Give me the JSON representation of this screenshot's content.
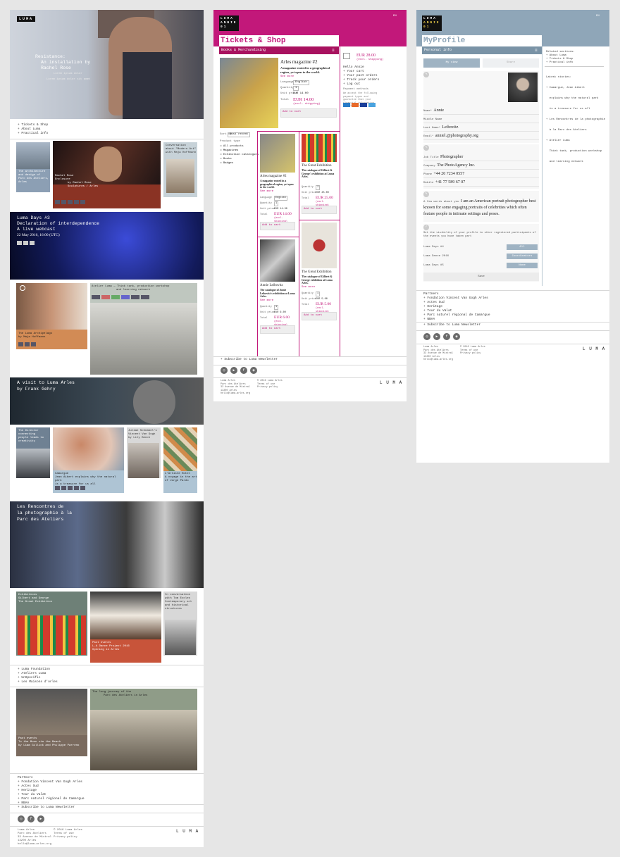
{
  "home": {
    "logo": "LUMA",
    "hero": {
      "title": "Resistance:",
      "subtitle": "An installation by",
      "artist": "Rachel Rose",
      "caption_line1": "Lorem ipsum dolor",
      "caption_line2": "Lorem ipsum dolor sit amet"
    },
    "top_links": [
      "+ Tickets & Shop",
      "+ About Luma",
      "+ Practical info"
    ],
    "tile_architecture": {
      "line1": "The architecture",
      "line2": "and design of",
      "line3": "Parc des Ateliers,",
      "line4": "Arles"
    },
    "tile_rachel": {
      "line1": "Rachel Rose",
      "line2": "Enclosure",
      "line3": "by Rachel Rose",
      "line4": "Sculptures / Arles"
    },
    "tile_hoffmann": {
      "line1": "Conversation",
      "line2": "about \"Modern Art\"",
      "line3": "with Maja Hoffmann"
    },
    "luma_days": {
      "line1": "Luma Days #3",
      "line2": "Declaration of interdependence",
      "line3": "A live webcast",
      "date": "22 May 2016, 16:00 (UTC)"
    },
    "tile_archipelago": {
      "line1": "The Luma Archipelago",
      "line2": "by Maja Hoffmann"
    },
    "tile_atelier": {
      "line1": "Atelier Luma",
      "line2": "— Think tank, production workshop",
      "line3": "and learning network"
    },
    "gehry": {
      "line1": "A visit to Luma Arles",
      "line2": "by Frank Gehry"
    },
    "tile_director": {
      "line1": "The Director",
      "line2": "connecting",
      "line3": "people leads to",
      "line4": "creativity"
    },
    "tile_camargue": {
      "line1": "Camargue",
      "line2": "Jean Aibert explains why the natural park",
      "line3": "is a treasure for us all"
    },
    "tile_vangogh": {
      "line1": "Julian Schnabel's",
      "line2": "Vincent Van Gogh",
      "line3": "by Lily Bench"
    },
    "tile_artiste": {
      "line1": "L'Artiste Hotel",
      "line2": "A voyage in the art",
      "line3": "of Jorge Pardo"
    },
    "rencontres": {
      "line1": "Les Rencontres de",
      "line2": "la photographie à la",
      "line3": "Parc des Ateliers"
    },
    "tile_gilbert": {
      "line1": "Exhibitions",
      "line2": "Gilbert and George",
      "line3": "The Great Exhibition"
    },
    "tile_santa": {
      "line1": "Past events",
      "line2": "L.A Dance Project 2016",
      "line3": "Opening in Arles"
    },
    "tile_ecoles": {
      "line1": "In conversation",
      "line2": "with Tom Eccles",
      "line3": "Contemporary art",
      "line4": "and historical",
      "line5": "structures"
    },
    "mid_links": [
      "+ Luma Foundation",
      "+ Ateliers Luma",
      "+ UnSpecific",
      "+ Les Maisons d'Arles"
    ],
    "tile_moon": {
      "line1": "Past events",
      "line2": "To the Moon via the Beach",
      "line3": "by Liam Gillick and Philippe Parreno"
    },
    "tile_journey": {
      "line1": "The long journey of the",
      "line2": "Parc des Ateliers in Arles"
    },
    "partners_title": "Partners",
    "partners": [
      "+ Fondation Vincent Van Gogh Arles",
      "+ Actes Sud",
      "+ Heritage",
      "+ Tour du Valat",
      "+ Parc naturel régional de Camargue",
      "+ NBAA"
    ],
    "newsletter": "+ Subscribe to Luma Newsletter",
    "footer_addr": [
      "Luma Arles",
      "Parc des Ateliers",
      "33 Avenue de Mistral",
      "13200 Arles",
      "hello@luma-arles.org"
    ],
    "footer_legal": [
      "© 2016 Luma Arles",
      "Terms of use",
      "Privacy policy"
    ],
    "wordmark": "L U M A"
  },
  "shop": {
    "logo_line1": "LUMA",
    "logo_line2": "ANNIE",
    "logo_line3": "01",
    "lang": "EN",
    "title": "Tickets & Shop",
    "section": "Books & Merchandising",
    "featured": {
      "title": "Arles magazine #2",
      "desc": "A magazine rooted in a geographical region, yet open to the world.",
      "see_more": "See more",
      "format_label": "Language",
      "format_value": "English",
      "qty_label": "Quantity",
      "qty_value": "1",
      "unit_label": "Unit price",
      "unit_value": "EUR 14.00",
      "total_label": "Total",
      "total_value": "EUR 14.00",
      "shipping": "(excl. shipping)",
      "cart": "Add to cart"
    },
    "cart": {
      "total": "EUR 28.00",
      "shipping": "(excl. shipping)",
      "greeting": "Hello Annie",
      "links": [
        "+ Your cart",
        "+ Your past orders",
        "+ Track your orders",
        "+ Log out"
      ],
      "payment_title": "Payment methods",
      "payment_text": "We accept the following payment types and guarantee that your financial information will be safe."
    },
    "sort_label": "Sort by",
    "sort_value": "Most recent",
    "filter_title": "Product type",
    "filters": [
      "All products",
      "Magazines",
      "Exhibition catalogues",
      "Books",
      "Badges"
    ],
    "products": [
      {
        "title": "Arles magazine #2",
        "desc": "A magazine rooted in a geographical region, yet open to the world.",
        "see_more": "See more",
        "unit": "EUR 14.00",
        "total": "EUR 14.00",
        "shipping": "(excl. shipping)",
        "cart": "Add to cart"
      },
      {
        "title": "The Great Exhibition",
        "desc": "The catalogue of Gilbert & George's exhibition at Luma Arles.",
        "see_more": "See more",
        "unit": "EUR 25.00",
        "total": "EUR 25.00",
        "shipping": "(excl. shipping)",
        "cart": "Add to cart"
      },
      {
        "title": "Annie Leibovitz",
        "desc": "The catalogue of Annie Leibovitz's exhibition at Luma Arles.",
        "see_more": "See more",
        "unit": "EUR 6.00",
        "total": "EUR 6.00",
        "shipping": "(excl. shipping)",
        "cart": "Add to cart"
      },
      {
        "title": "The Great Exhibition",
        "desc": "The catalogue of Gilbert & George exhibition at Luma Arles.",
        "see_more": "See more",
        "unit": "EUR 5.00",
        "total": "EUR 5.00",
        "shipping": "(excl. shipping)",
        "cart": "Add to cart"
      }
    ],
    "qty_label": "Quantity",
    "unit_label": "Unit price",
    "total_label": "Total",
    "lang_label": "Language",
    "lang_value": "English",
    "newsletter": "+ Subscribe to Luma Newsletter",
    "footer_addr": [
      "Luma Arles",
      "Parc des Ateliers",
      "33 Avenue de Mistral",
      "13200 Arles",
      "hello@luma-arles.org"
    ],
    "footer_legal": [
      "© 2016 Luma Arles",
      "Terms of use",
      "Privacy policy"
    ],
    "wordmark": "L U M A"
  },
  "profile": {
    "logo_line1": "LUMA",
    "logo_line2": "ANNIE",
    "logo_line3": "01",
    "lang": "EN",
    "title": "MyProfile",
    "section": "Personal info",
    "tab_active": "My view",
    "tab_other": "Share",
    "fields": [
      {
        "label": "Name*",
        "value": "Annie"
      },
      {
        "label": "Middle Name",
        "value": ""
      },
      {
        "label": "Last Name*",
        "value": "Leibovitz"
      },
      {
        "label": "Email*",
        "value": "anniel.@photography.org"
      }
    ],
    "job_fields": [
      {
        "label": "Job Title",
        "value": "Photographer"
      },
      {
        "label": "Company",
        "value": "The PhotoAgency Inc."
      },
      {
        "label": "Phone",
        "value": "+44 20 7234 0557"
      },
      {
        "label": "Mobile",
        "value": "+41 77 589 67 07"
      }
    ],
    "about_label": "A few words about you",
    "about_text": "I am an American portrait photographer best known for some engaging portraits of celebrities which often feature people in intimate settings and poses.",
    "visibility_text": "Set the visibility of your profile to other registered participants of the events you have taken part",
    "events": [
      {
        "name": "Luma Days #4",
        "value": "All"
      },
      {
        "name": "Luma Dance 2016",
        "value": "Coordinators"
      },
      {
        "name": "Luma Days #5",
        "value": "None"
      }
    ],
    "save": "Save",
    "related_title": "Related sections:",
    "related": [
      "+ About Luma",
      "+ Tickets & Shop",
      "+ Practical info"
    ],
    "latest_title": "Latest stories:",
    "latest": [
      "+ Camargue, Jean Aibert",
      "  explains why the natural park",
      "  is a treasure for us all",
      "+ Les Rencontres de la photographie",
      "  à la Parc des Ateliers",
      "+ Atelier Luma",
      "  Think tank, production workshop",
      "  and learning network"
    ],
    "partners_title": "Partners",
    "partners": [
      "+ Fondation Vincent Van Gogh Arles",
      "+ Actes Sud",
      "+ Heritage",
      "+ Tour du Valat",
      "+ Parc naturel régional de Camargue",
      "+ NBAA"
    ],
    "newsletter": "+ Subscribe to Luma Newsletter",
    "footer_addr": [
      "Luma Arles",
      "Parc des Ateliers",
      "33 Avenue de Mistral",
      "13200 Arles",
      "hello@luma-arles.org"
    ],
    "footer_legal": [
      "© 2016 Luma Arles",
      "Terms of use",
      "Privacy policy"
    ],
    "wordmark": "L U M A"
  },
  "colors": {
    "pink": "#c2187a",
    "steel": "#8fa6b8",
    "dark": "#111111"
  },
  "icons": [
    "menu-icon",
    "cart-icon",
    "play-icon",
    "instagram-icon",
    "youtube-icon",
    "facebook-icon",
    "edit-icon",
    "checkbox-icon"
  ]
}
